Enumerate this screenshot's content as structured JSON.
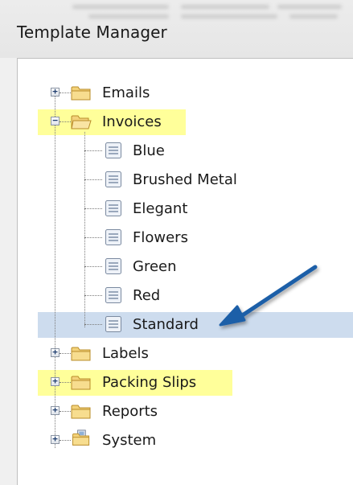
{
  "window": {
    "title": "Template Manager"
  },
  "tree": {
    "nodes": [
      {
        "label": "Emails",
        "icon": "folder-icon",
        "expander": "+",
        "highlight": "none"
      },
      {
        "label": "Invoices",
        "icon": "folder-open-icon",
        "expander": "−",
        "highlight": "yellow",
        "children": [
          {
            "label": "Blue",
            "icon": "document-icon"
          },
          {
            "label": "Brushed Metal",
            "icon": "document-icon"
          },
          {
            "label": "Elegant",
            "icon": "document-icon"
          },
          {
            "label": "Flowers",
            "icon": "document-icon"
          },
          {
            "label": "Green",
            "icon": "document-icon"
          },
          {
            "label": "Red",
            "icon": "document-icon"
          },
          {
            "label": "Standard",
            "icon": "document-icon",
            "selected": true
          }
        ]
      },
      {
        "label": "Labels",
        "icon": "folder-icon",
        "expander": "+",
        "highlight": "none"
      },
      {
        "label": "Packing Slips",
        "icon": "folder-icon",
        "expander": "+",
        "highlight": "yellow"
      },
      {
        "label": "Reports",
        "icon": "folder-icon",
        "expander": "+",
        "highlight": "none"
      },
      {
        "label": "System",
        "icon": "folder-system-icon",
        "expander": "+",
        "highlight": "none"
      }
    ]
  },
  "colors": {
    "highlight_yellow": "#ffff9a",
    "selection": "#cddcee",
    "annotation_arrow": "#1f5fa8"
  }
}
